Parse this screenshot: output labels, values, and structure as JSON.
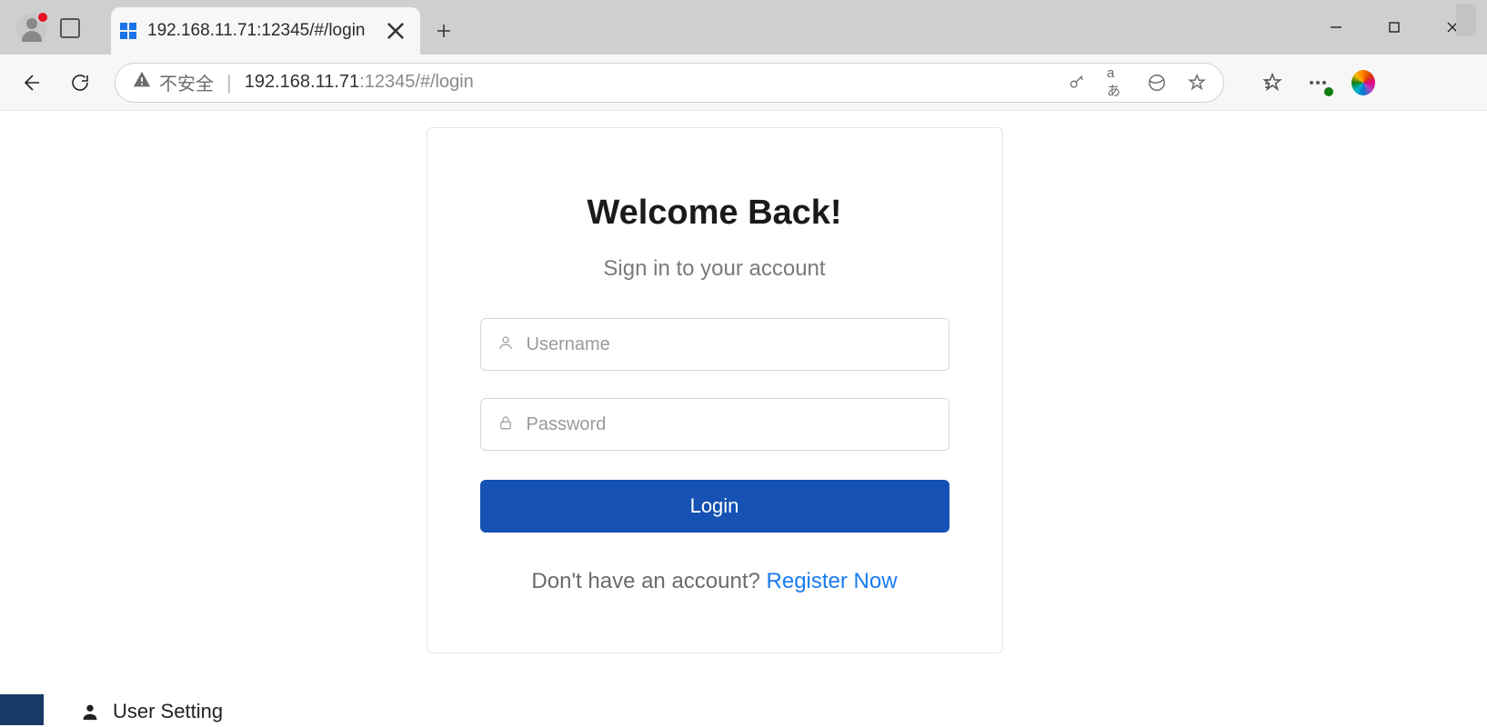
{
  "browser": {
    "tab_title": "192.168.11.71:12345/#/login",
    "url_prefix": "192.168.11.71",
    "url_port_path": ":12345/#/login",
    "not_secure_label": "不安全"
  },
  "login": {
    "title": "Welcome Back!",
    "subtitle": "Sign in to your account",
    "username_placeholder": "Username",
    "password_placeholder": "Password",
    "login_button": "Login",
    "no_account_text": "Don't have an account? ",
    "register_link": "Register Now"
  },
  "footer": {
    "user_setting_label": "User Setting"
  }
}
